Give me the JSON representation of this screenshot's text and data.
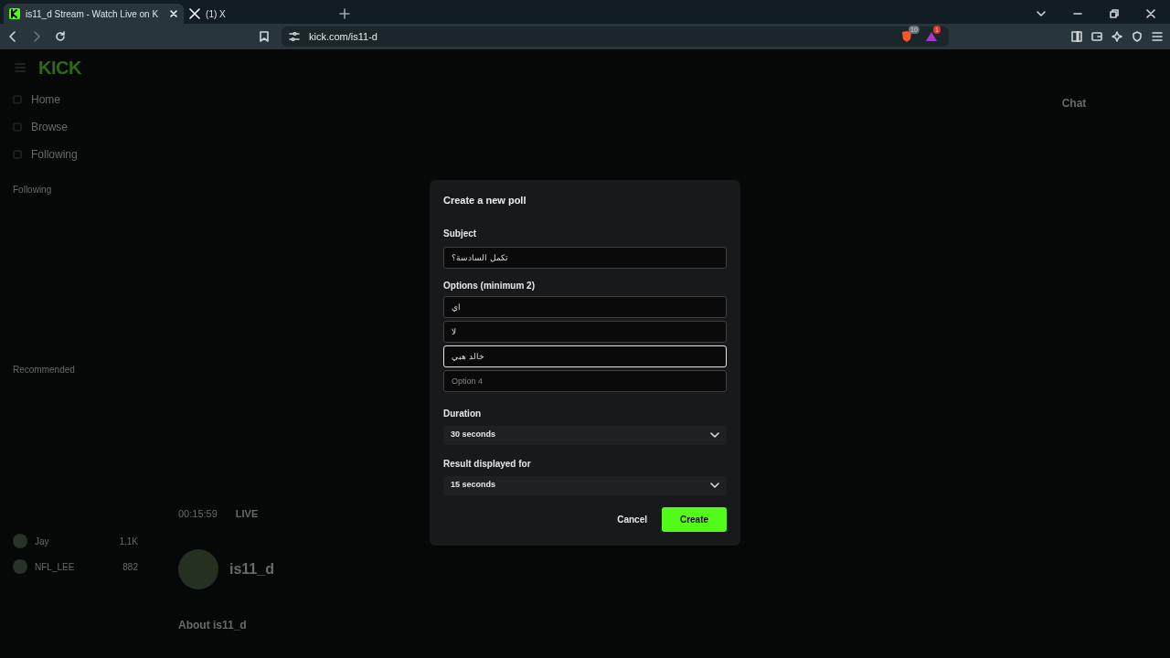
{
  "browser": {
    "tabs": [
      {
        "title": "is11_d Stream - Watch Live on K",
        "selected": true,
        "kind": "kick"
      },
      {
        "title": "(1) X",
        "selected": false,
        "kind": "x"
      }
    ],
    "address": "kick.com/is11-d",
    "shield_count": "10",
    "rewards_count": "1"
  },
  "site": {
    "logo": "KICK",
    "nav": [
      "Home",
      "Browse",
      "Following"
    ],
    "following_heading": "Following",
    "recommended_heading": "Recommended",
    "recommended": [
      {
        "name": "Jay",
        "viewers": "1.1K"
      },
      {
        "name": "NFL_LEE",
        "viewers": "882"
      }
    ],
    "player": {
      "time": "00:15:59",
      "live": "LIVE"
    },
    "channel": {
      "name": "is11_d",
      "about": "About is11_d"
    },
    "chat": {
      "title": "Chat"
    }
  },
  "poll": {
    "title": "Create a new poll",
    "subject": {
      "label": "Subject",
      "value": "تكمل السادسة؟"
    },
    "options_label": "Options (minimum 2)",
    "options": [
      {
        "value": "اي",
        "focused": false
      },
      {
        "value": "لا",
        "focused": false
      },
      {
        "value": "خالد هبي",
        "focused": true
      },
      {
        "placeholder": "Option 4",
        "focused": false
      }
    ],
    "duration": {
      "label": "Duration",
      "value": "30 seconds"
    },
    "result": {
      "label": "Result displayed for",
      "value": "15 seconds"
    },
    "buttons": [
      {
        "label": "Cancel",
        "kind": "secondary"
      },
      {
        "label": "Create",
        "kind": "primary"
      }
    ]
  }
}
